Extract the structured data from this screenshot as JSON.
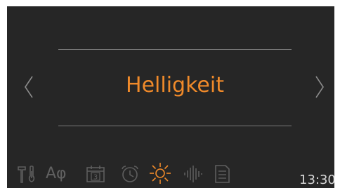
{
  "screen": {
    "title": "Helligkeit",
    "time": "13:30",
    "title_color": "#f08a2a",
    "active_icon_color": "#f08a2a",
    "inactive_icon_color": "#5e5e5e"
  },
  "navigation": {
    "prev_icon": "chevron-left-icon",
    "next_icon": "chevron-right-icon"
  },
  "menu_icons": [
    {
      "name": "tools-thermometer-icon",
      "active": false
    },
    {
      "name": "language-icon",
      "label": "Aφ",
      "active": false
    },
    {
      "name": "calendar-icon",
      "label": "3",
      "active": false
    },
    {
      "name": "alarm-clock-icon",
      "active": false
    },
    {
      "name": "brightness-sun-icon",
      "active": true
    },
    {
      "name": "sound-wave-icon",
      "active": false
    },
    {
      "name": "document-icon",
      "active": false
    }
  ]
}
